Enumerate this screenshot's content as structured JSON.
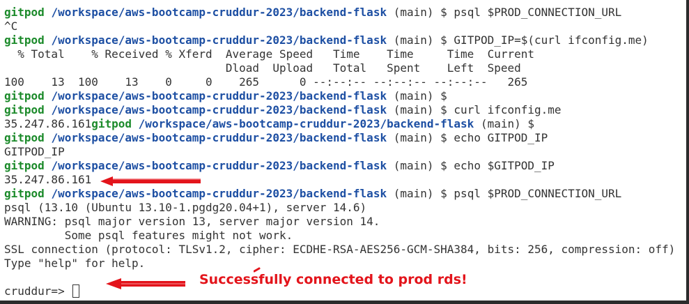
{
  "prompt": {
    "user": "gitpod",
    "path": "/workspace/aws-bootcamp-cruddur-2023/backend-flask",
    "branch": "(main) $"
  },
  "lines": {
    "l1_cmd": "psql $PROD_CONNECTION_URL",
    "l2_out": "^C",
    "l3_cmd": "GITPOD_IP=$(curl ifconfig.me)",
    "l4_out": "  % Total    % Received % Xferd  Average Speed   Time    Time     Time  Current",
    "l5_out": "                                 Dload  Upload   Total   Spent    Left  Speed",
    "l6_out": "100    13  100    13    0     0    265      0 --:--:-- --:--:-- --:--:--   265",
    "l7_cmd": "",
    "l8_cmd": "curl ifconfig.me",
    "l9_ip": "35.247.86.161",
    "l10_cmd": "echo GITPOD_IP",
    "l11_out": "GITPOD_IP",
    "l12_cmd": "echo $GITPOD_IP",
    "l13_out": "35.247.86.161",
    "l14_cmd": "psql $PROD_CONNECTION_URL",
    "l15_out": "psql (13.10 (Ubuntu 13.10-1.pgdg20.04+1), server 14.6)",
    "l16_out": "WARNING: psql major version 13, server major version 14.",
    "l17_out": "         Some psql features might not work.",
    "l18_out": "SSL connection (protocol: TLSv1.2, cipher: ECDHE-RSA-AES256-GCM-SHA384, bits: 256, compression: off)",
    "l19_out": "Type \"help\" for help.",
    "l20_out": "",
    "l21_prompt": "cruddur=> "
  },
  "annotation": {
    "text": "Successfully connected to prod rds!",
    "color": "#e3141b"
  },
  "colors": {
    "user": "#1b8a2a",
    "path": "#1d4fa3",
    "text": "#333333",
    "background": "#ffffff",
    "annotation": "#e3141b"
  },
  "icons": {
    "arrows": "red-hand-drawn-arrow-icon"
  }
}
